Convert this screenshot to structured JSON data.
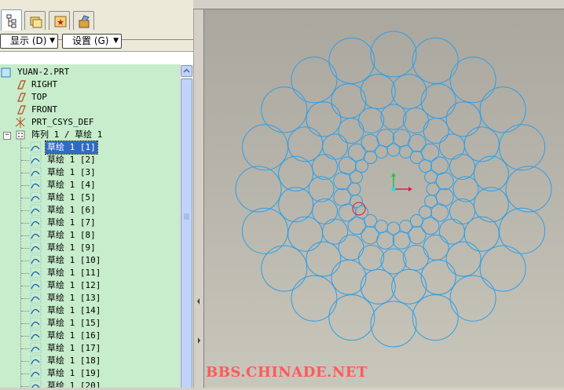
{
  "tabs": [
    {
      "name": "model-tree-tab",
      "icon": "model-tree-icon",
      "active": true
    },
    {
      "name": "folder-browser-tab",
      "icon": "folder-icon",
      "active": false
    },
    {
      "name": "favorites-tab",
      "icon": "favorites-icon",
      "active": false
    },
    {
      "name": "connections-tab",
      "icon": "connections-icon",
      "active": false
    }
  ],
  "toolbar": {
    "show_label": "显示 (D)",
    "settings_label": "设置 (G)"
  },
  "tree": {
    "root": "YUAN-2.PRT",
    "datums": [
      {
        "label": "RIGHT",
        "icon": "datum-plane-icon"
      },
      {
        "label": "TOP",
        "icon": "datum-plane-icon"
      },
      {
        "label": "FRONT",
        "icon": "datum-plane-icon"
      },
      {
        "label": "PRT_CSYS_DEF",
        "icon": "coordinate-system-icon"
      }
    ],
    "pattern": "阵列 1 / 草绘 1",
    "sketches": [
      "草绘 1 [1]",
      "草绘 1 [2]",
      "草绘 1 [3]",
      "草绘 1 [4]",
      "草绘 1 [5]",
      "草绘 1 [6]",
      "草绘 1 [7]",
      "草绘 1 [8]",
      "草绘 1 [9]",
      "草绘 1 [10]",
      "草绘 1 [11]",
      "草绘 1 [12]",
      "草绘 1 [13]",
      "草绘 1 [14]",
      "草绘 1 [15]",
      "草绘 1 [16]",
      "草绘 1 [17]",
      "草绘 1 [18]",
      "草绘 1 [19]",
      "草绘 1 [20]"
    ],
    "selected_index": 0
  },
  "watermark": "BBS.CHINADE.NET",
  "colors": {
    "tree_bg": "#c7edcc",
    "circle_stroke": "#2e9fe6",
    "selected_circle": "#dd1a2a",
    "selection_bg": "#316ac5",
    "watermark": "#ff5a5a"
  }
}
